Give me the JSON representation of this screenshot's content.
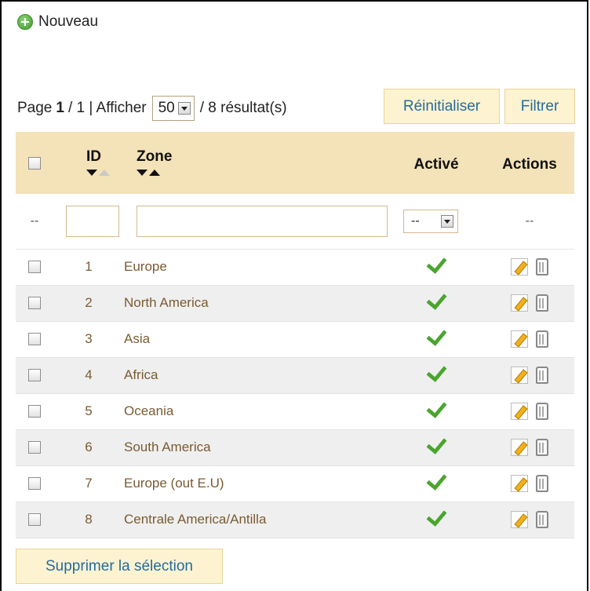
{
  "toolbar": {
    "new_label": "Nouveau"
  },
  "pager": {
    "page_prefix": "Page",
    "page_current": "1",
    "page_total_text": " / 1 | Afficher",
    "per_page": "50",
    "results_text": "/ 8 résultat(s)"
  },
  "buttons": {
    "reset_label": "Réinitialiser",
    "filter_label": "Filtrer",
    "delete_selection_label": "Supprimer la sélection"
  },
  "table": {
    "headers": {
      "id": "ID",
      "zone": "Zone",
      "active": "Activé",
      "actions": "Actions"
    },
    "filters": {
      "check_placeholder": "--",
      "active_value": "--",
      "actions_placeholder": "--"
    },
    "rows": [
      {
        "id": "1",
        "zone": "Europe"
      },
      {
        "id": "2",
        "zone": "North America"
      },
      {
        "id": "3",
        "zone": "Asia"
      },
      {
        "id": "4",
        "zone": "Africa"
      },
      {
        "id": "5",
        "zone": "Oceania"
      },
      {
        "id": "6",
        "zone": "South America"
      },
      {
        "id": "7",
        "zone": "Europe (out E.U)"
      },
      {
        "id": "8",
        "zone": "Centrale America/Antilla"
      }
    ]
  },
  "colors": {
    "header_bg": "#f4e2b8",
    "button_bg": "#fdf3d0",
    "link_blue": "#246b9f",
    "text_brown": "#7a5b33",
    "check_green": "#4aa52e"
  },
  "icons": {
    "new": "plus-circle-icon",
    "active": "checkmark-icon",
    "edit": "pencil-icon",
    "delete": "trash-icon"
  }
}
